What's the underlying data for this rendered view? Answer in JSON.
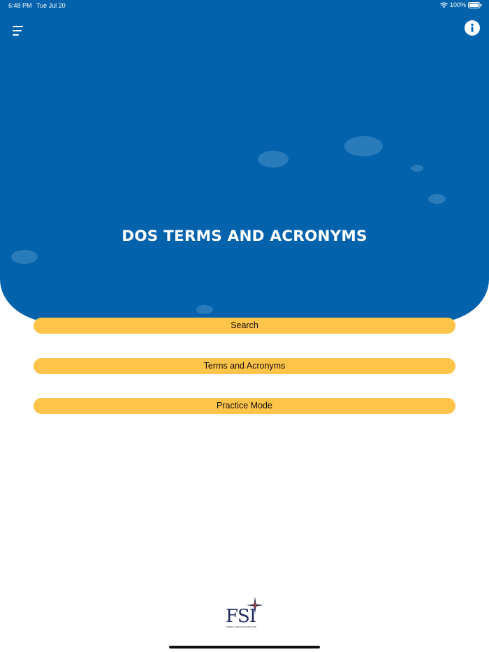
{
  "status_bar": {
    "time": "6:48 PM",
    "date": "Tue Jul 20",
    "battery": "100%",
    "icons": [
      "wifi-icon",
      "battery-icon"
    ]
  },
  "header": {
    "menu_icon": "hamburger-menu-icon",
    "info_icon": "info-icon",
    "title": "DOS TERMS AND ACRONYMS"
  },
  "menu": {
    "items": [
      {
        "label": "Search"
      },
      {
        "label": "Terms and Acronyms"
      },
      {
        "label": "Practice Mode"
      }
    ]
  },
  "footer": {
    "logo_text": "FSI",
    "logo_caption": "FOREIGN SERVICE INSTITUTE"
  },
  "colors": {
    "hero_background": "#0262ac",
    "button_background": "#fec349",
    "button_text": "#111111",
    "title_text": "#ffffff"
  }
}
